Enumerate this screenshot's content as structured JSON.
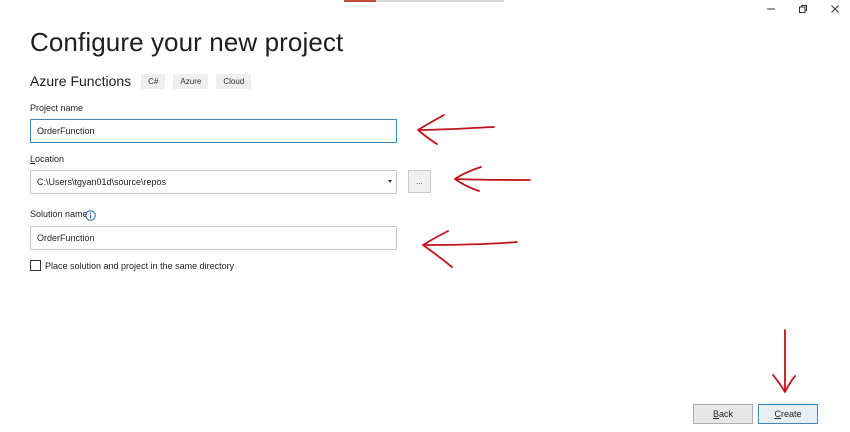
{
  "window": {
    "controls": {
      "minimize_icon": "minimize-icon",
      "maximize_icon": "restore-icon",
      "close_icon": "close-icon"
    },
    "progress_fraction": 0.2
  },
  "page": {
    "title": "Configure your new project"
  },
  "template": {
    "name": "Azure Functions",
    "tags": [
      "C#",
      "Azure",
      "Cloud"
    ]
  },
  "fields": {
    "project_name": {
      "label": "Project name",
      "value": "OrderFunction"
    },
    "location": {
      "label": "Location",
      "value": "C:\\Users\\tgyan01d\\source\\repos",
      "browse_label": "..."
    },
    "solution_name": {
      "label": "Solution name",
      "value": "OrderFunction",
      "info_icon": "info-icon"
    }
  },
  "options": {
    "same_directory_label": "Place solution and project in the same directory",
    "same_directory_checked": false
  },
  "buttons": {
    "back": "Back",
    "create": "Create"
  },
  "annotations": {
    "arrow_color": "#c0141c"
  }
}
